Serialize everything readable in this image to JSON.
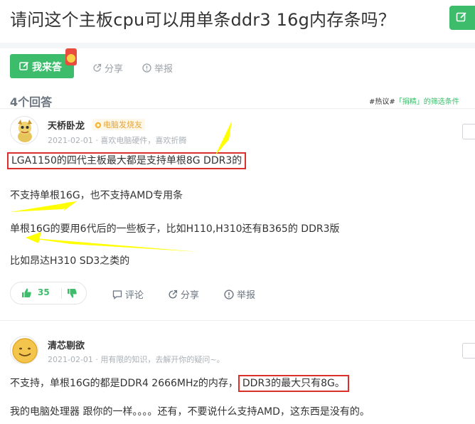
{
  "question": {
    "title": "请问这个主板cpu可以用单条ddr3 16g内存条吗？"
  },
  "actions": {
    "answer_label": "我来答",
    "share_label": "分享",
    "report_label": "举报"
  },
  "answers_header": {
    "count_label": "4个回答",
    "filter_note_prefix": "#热议#",
    "filter_note_link": "「捐精」的筛选条件"
  },
  "answers": [
    {
      "username": "天桥卧龙",
      "badge": "电脑发烧友",
      "meta": "2021-02-01 · 喜欢电脑硬件，喜欢折腾",
      "paragraphs": [
        "LGA1150的四代主板最大都是支持单根8G DDR3的",
        "不支持单根16G，也不支持AMD专用条",
        "单根16G的要用6代后的一些板子，比如H110,H310还有B365的 DDR3版",
        "比如昂达H310 SD3之类的"
      ],
      "likes": "35",
      "comment_label": "评论",
      "share_label": "分享",
      "report_label": "举报"
    },
    {
      "username": "清芯剔欲",
      "meta": "2021-02-01 · 用有限的知识，去解开你的疑问~。",
      "paragraph1_a": "不支持，单根16G的都是DDR4 2666MHz的内存，",
      "paragraph1_b": "DDR3的最大只有8G。",
      "paragraph2": "我的电脑处理器 跟你的一样。。。。还有，不要说什么支持AMD，这东西是没有的。"
    }
  ],
  "colors": {
    "accent": "#3dbd6b",
    "highlight_box": "#d9302c",
    "arrow": "#ffff00",
    "badge": "#e6a53a"
  }
}
